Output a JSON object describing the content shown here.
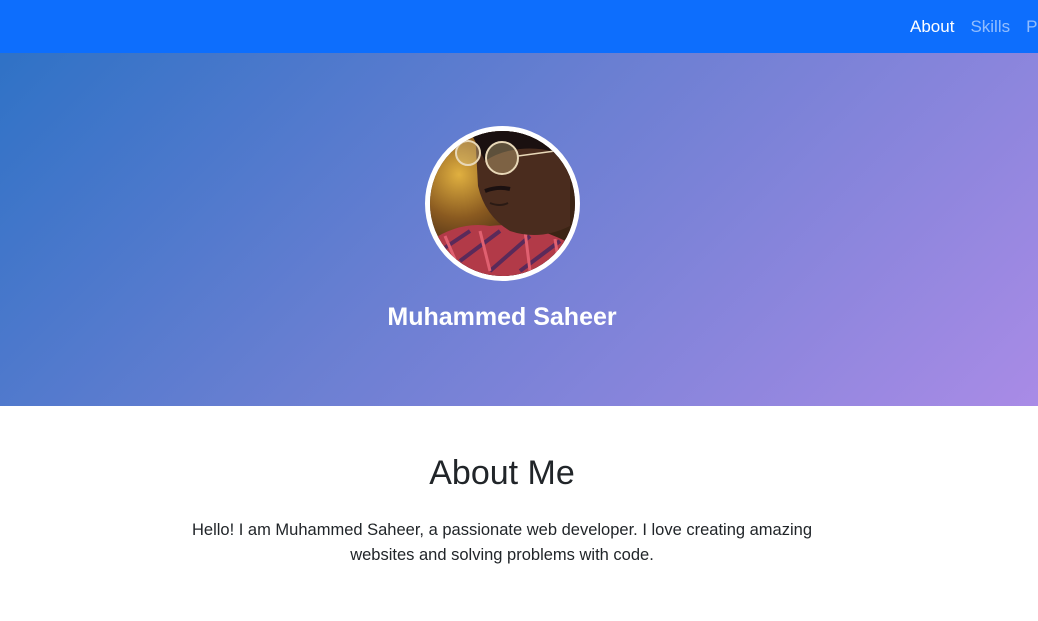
{
  "nav": {
    "links": [
      "About",
      "Skills",
      "Pr"
    ],
    "active_index": 0,
    "bg_color": "#0d6efd"
  },
  "hero": {
    "name": "Muhammed Saheer",
    "avatar_alt": "profile photo",
    "gradient_colors": [
      "#2f72c6",
      "#a98be6"
    ]
  },
  "about": {
    "title": "About Me",
    "text": "Hello! I am Muhammed Saheer, a passionate web developer. I love creating amazing websites and solving problems with code."
  }
}
